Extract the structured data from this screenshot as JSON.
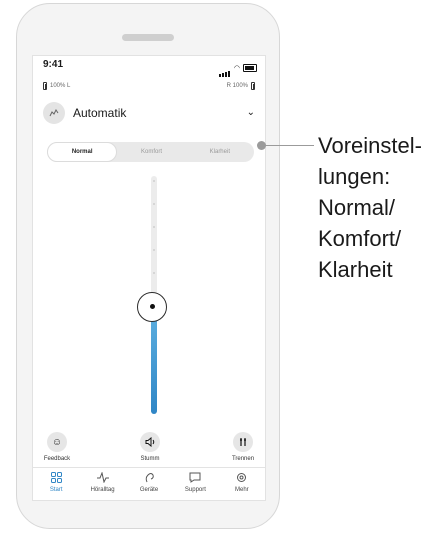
{
  "status": {
    "time": "9:41"
  },
  "battery": {
    "left": "100% L",
    "right": "R 100%"
  },
  "program": {
    "name": "Automatik"
  },
  "presets": {
    "items": [
      "Normal",
      "Komfort",
      "Klarheit"
    ],
    "selected": "Normal"
  },
  "volume": {
    "level": 0.45
  },
  "actions": {
    "feedback": "Feedback",
    "mute": "Stumm",
    "disconnect": "Trennen"
  },
  "tabs": [
    "Start",
    "Höralltag",
    "Geräte",
    "Support",
    "Mehr"
  ],
  "callout": {
    "lines": [
      "Voreinstel-",
      "lungen:",
      "Normal/",
      "Komfort/",
      "Klarheit"
    ]
  },
  "colors": {
    "accent": "#2f86c6"
  },
  "icons": {
    "program": "hearing-program-icon",
    "feedback": "smiley-icon",
    "mute": "speaker-icon",
    "disconnect": "disconnect-icon",
    "tabs": [
      "grid-icon",
      "activity-icon",
      "hearing-aid-icon",
      "chat-icon",
      "gear-icon"
    ]
  }
}
